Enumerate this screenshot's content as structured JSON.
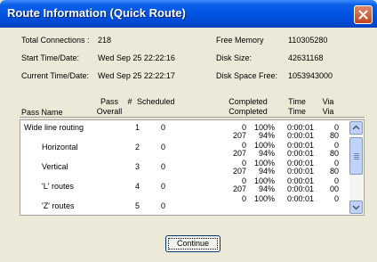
{
  "window": {
    "title": "Route Information (Quick Route)"
  },
  "info": {
    "total_connections_label": "Total Connections :",
    "total_connections_value": "218",
    "start_time_label": "Start Time/Date:",
    "start_time_value": "Wed Sep 25 22:22:16",
    "current_time_label": "Current Time/Date:",
    "current_time_value": "Wed Sep 25 22:22:17",
    "free_memory_label": "Free Memory",
    "free_memory_value": "110305280",
    "disk_size_label": "Disk Size:",
    "disk_size_value": "42631168",
    "disk_space_free_label": "Disk Space Free:",
    "disk_space_free_value": "1053943000"
  },
  "columns": {
    "pass_name": "Pass Name",
    "pass_overall_1": "Pass",
    "pass_overall_2": "Overall",
    "hash": "#",
    "scheduled": "Scheduled",
    "completed_1": "Completed",
    "completed_2": "Completed",
    "time_1": "Time",
    "time_2": "Time",
    "via_1": "Via",
    "via_2": "Via"
  },
  "rows": [
    {
      "name": "Wide line routing",
      "pass": "1",
      "scheduled": "0",
      "l1_count": "0",
      "l1_pct": "100%",
      "l1_time": "0:00:01",
      "l1_via": "0",
      "l2_count": "207",
      "l2_pct": "94%",
      "l2_time": "0:00:01",
      "l2_via": "80"
    },
    {
      "name": "Horizontal",
      "pass": "2",
      "scheduled": "0",
      "l1_count": "0",
      "l1_pct": "100%",
      "l1_time": "0:00:01",
      "l1_via": "0",
      "l2_count": "207",
      "l2_pct": "94%",
      "l2_time": "0:00:01",
      "l2_via": "80"
    },
    {
      "name": "Vertical",
      "pass": "3",
      "scheduled": "0",
      "l1_count": "0",
      "l1_pct": "100%",
      "l1_time": "0:00:01",
      "l1_via": "0",
      "l2_count": "207",
      "l2_pct": "94%",
      "l2_time": "0:00:01",
      "l2_via": "80"
    },
    {
      "name": "'L' routes",
      "pass": "4",
      "scheduled": "0",
      "l1_count": "0",
      "l1_pct": "100%",
      "l1_time": "0:00:01",
      "l1_via": "0",
      "l2_count": "207",
      "l2_pct": "94%",
      "l2_time": "0:00:01",
      "l2_via": "00"
    },
    {
      "name": "'Z' routes",
      "pass": "5",
      "scheduled": "0",
      "l1_count": "0",
      "l1_pct": "100%",
      "l1_time": "0:00:01",
      "l1_via": "0",
      "l2_count": "",
      "l2_pct": "",
      "l2_time": "",
      "l2_via": ""
    }
  ],
  "buttons": {
    "continue": "Continue"
  },
  "colors": {
    "titlebar": "#0054e3",
    "dialog": "#ece9d8",
    "scrollbar": "#c1d3fb"
  }
}
